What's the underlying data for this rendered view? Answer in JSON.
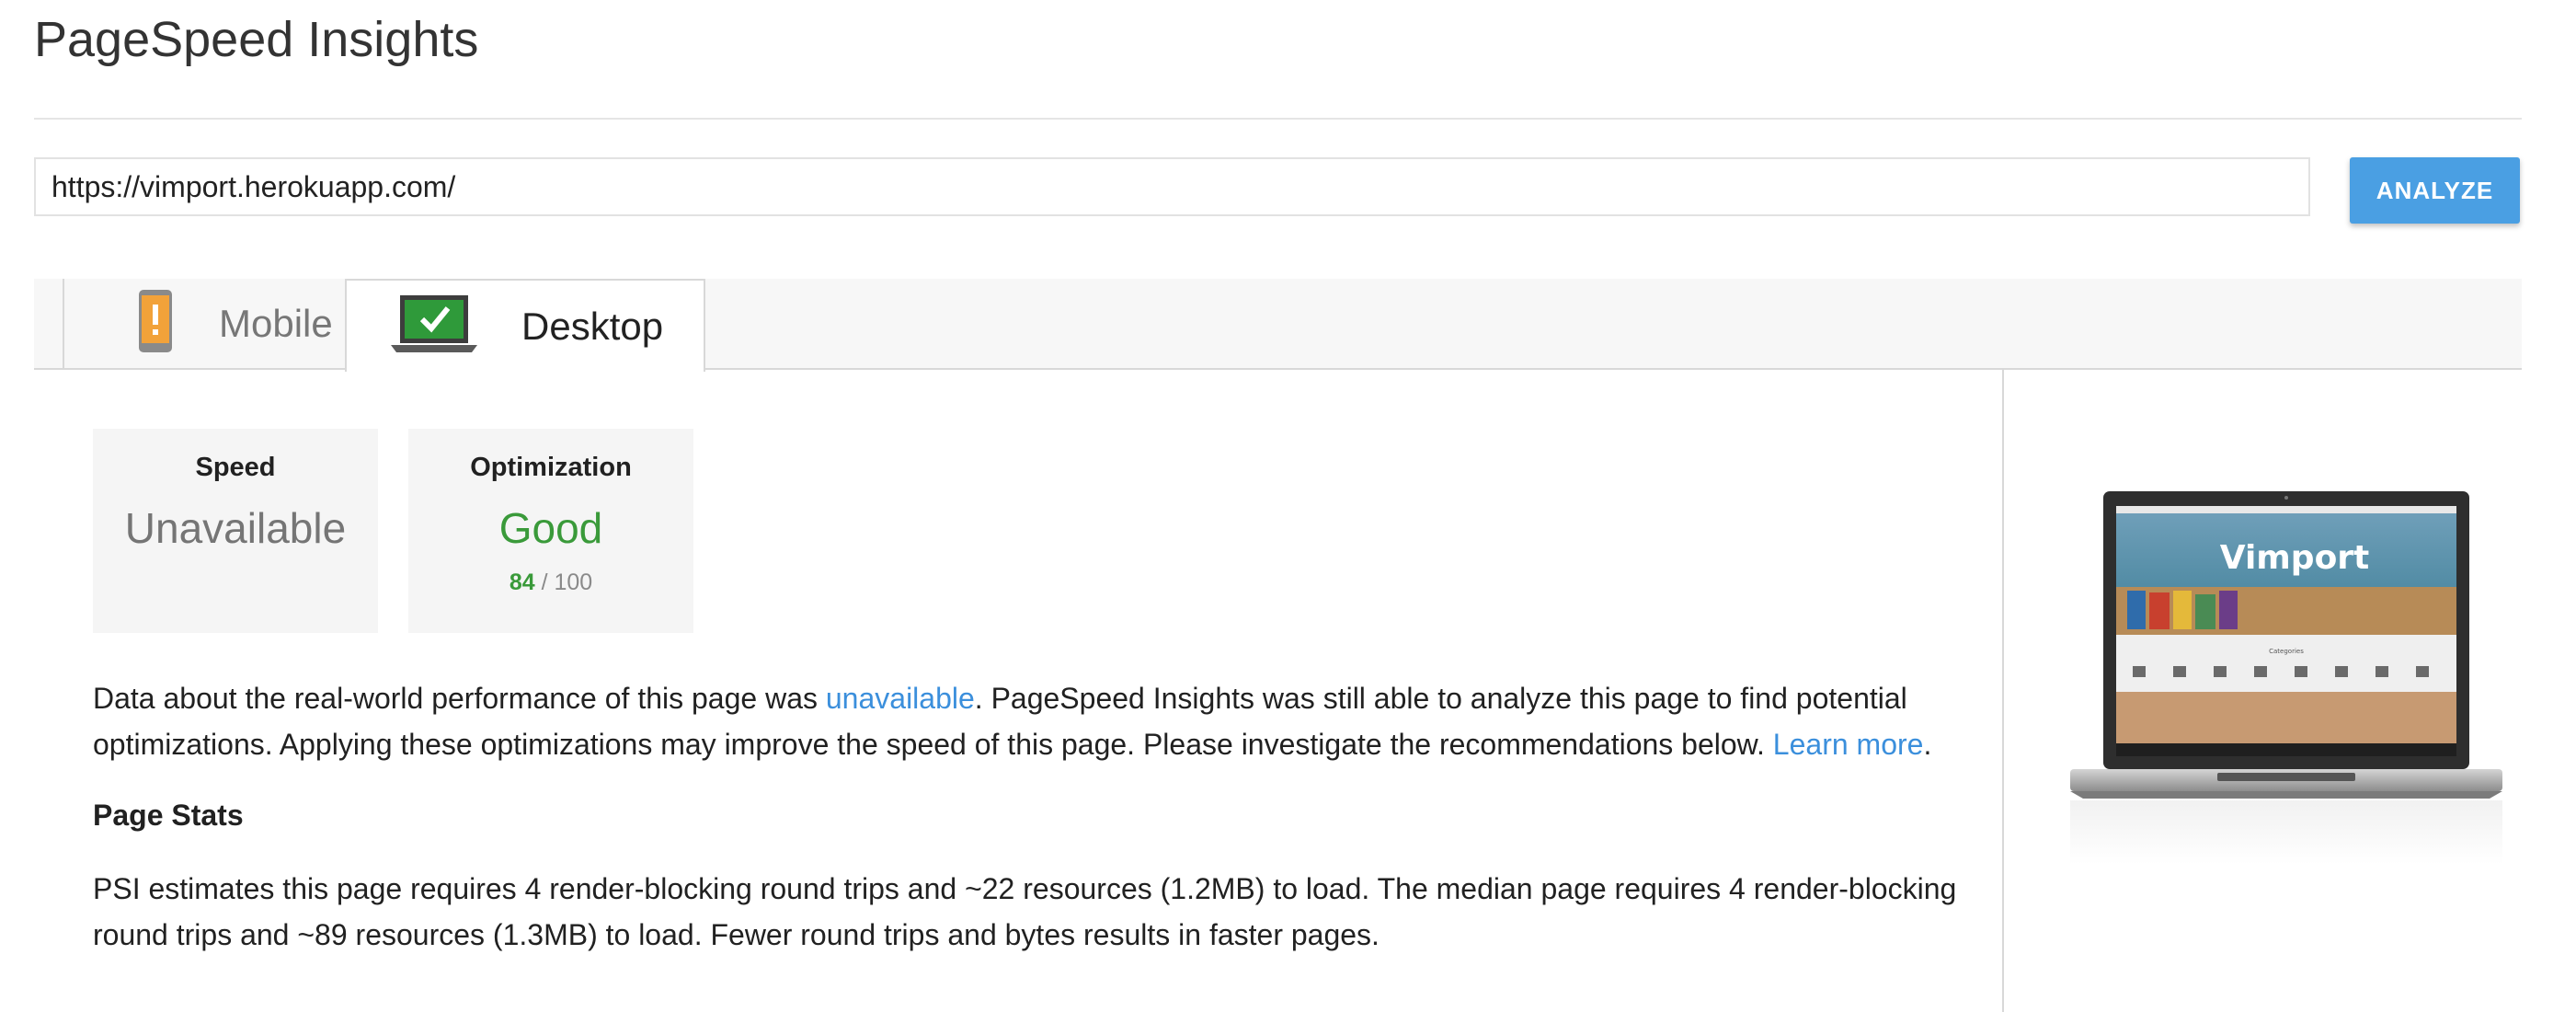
{
  "app": {
    "title": "PageSpeed Insights"
  },
  "search": {
    "url_value": "https://vimport.herokuapp.com/",
    "analyze_label": "ANALYZE"
  },
  "tabs": [
    {
      "label": "Mobile",
      "icon": "mobile-warning-icon",
      "selected": false
    },
    {
      "label": "Desktop",
      "icon": "laptop-check-icon",
      "selected": true
    }
  ],
  "scores": {
    "speed": {
      "title": "Speed",
      "value": "Unavailable"
    },
    "optimization": {
      "title": "Optimization",
      "value": "Good",
      "score": "84",
      "max": "/ 100"
    }
  },
  "intro": {
    "before_link": "Data about the real-world performance of this page was ",
    "link_unavailable": "unavailable",
    "after_link": ". PageSpeed Insights was still able to analyze this page to find potential optimizations. Applying these optimizations may improve the speed of this page. Please investigate the recommendations below. ",
    "link_learn_more": "Learn more",
    "end": "."
  },
  "page_stats": {
    "title": "Page Stats",
    "text": "PSI estimates this page requires 4 render-blocking round trips and ~22 resources (1.2MB) to load. The median page requires 4 render-blocking round trips and ~89 resources (1.3MB) to load. Fewer round trips and bytes results in faster pages."
  },
  "preview": {
    "site_name": "Vimport",
    "section_label": "Categories"
  },
  "colors": {
    "accent": "#4a9fe3",
    "good": "#3a9a3a",
    "link": "#3b8fdc",
    "warning": "#f2a23a"
  }
}
